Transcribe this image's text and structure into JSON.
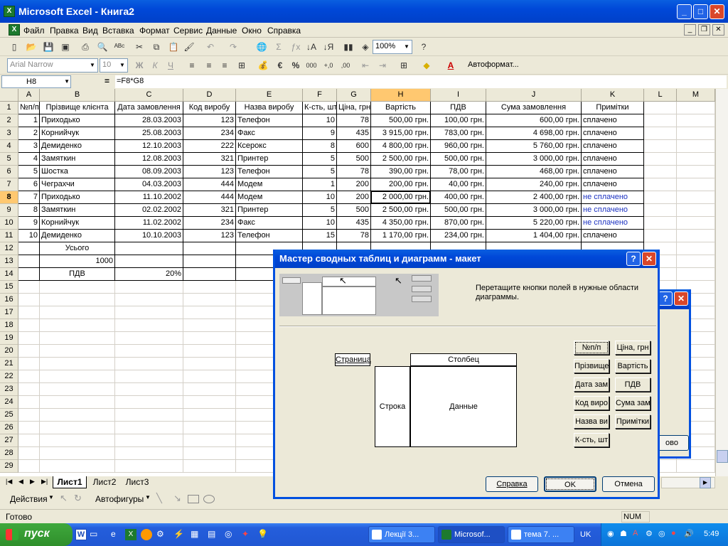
{
  "window": {
    "title": "Microsoft Excel - Книга2"
  },
  "menu": [
    "Файл",
    "Правка",
    "Вид",
    "Вставка",
    "Формат",
    "Сервис",
    "Данные",
    "Окно",
    "Справка"
  ],
  "toolbar": {
    "zoom": "100%",
    "font": "Arial Narrow",
    "size": "10",
    "autoformat": "Автоформат..."
  },
  "formula": {
    "name_box": "H8",
    "eq": "=",
    "content": "=F8*G8"
  },
  "columns": [
    "A",
    "B",
    "C",
    "D",
    "E",
    "F",
    "G",
    "H",
    "I",
    "J",
    "K",
    "L",
    "M"
  ],
  "rows": [
    "1",
    "2",
    "3",
    "4",
    "5",
    "6",
    "7",
    "8",
    "9",
    "10",
    "11",
    "12",
    "13",
    "14",
    "15",
    "16",
    "17",
    "18",
    "19",
    "20",
    "21",
    "22",
    "23",
    "24",
    "25",
    "26",
    "27",
    "28",
    "29"
  ],
  "table": {
    "headers": [
      "№п/п",
      "Прізвище клієнта",
      "Дата замовлення",
      "Код виробу",
      "Назва виробу",
      "К-сть, шт",
      "Ціна, грн",
      "Вартість",
      "ПДВ",
      "Сума замовлення",
      "Примітки"
    ],
    "rows": [
      [
        "1",
        "Приходько",
        "28.03.2003",
        "123",
        "Телефон",
        "10",
        "78",
        "500,00 грн.",
        "100,00 грн.",
        "600,00 грн.",
        "сплачено"
      ],
      [
        "2",
        "Корнийчук",
        "25.08.2003",
        "234",
        "Факс",
        "9",
        "435",
        "3 915,00 грн.",
        "783,00 грн.",
        "4 698,00 грн.",
        "сплачено"
      ],
      [
        "3",
        "Демиденко",
        "12.10.2003",
        "222",
        "Ксерокс",
        "8",
        "600",
        "4 800,00 грн.",
        "960,00 грн.",
        "5 760,00 грн.",
        "сплачено"
      ],
      [
        "4",
        "Замяткин",
        "12.08.2003",
        "321",
        "Принтер",
        "5",
        "500",
        "2 500,00 грн.",
        "500,00 грн.",
        "3 000,00 грн.",
        "сплачено"
      ],
      [
        "5",
        "Шостка",
        "08.09.2003",
        "123",
        "Телефон",
        "5",
        "78",
        "390,00 грн.",
        "78,00 грн.",
        "468,00 грн.",
        "сплачено"
      ],
      [
        "6",
        "Чеграхчи",
        "04.03.2003",
        "444",
        "Модем",
        "1",
        "200",
        "200,00 грн.",
        "40,00 грн.",
        "240,00 грн.",
        "сплачено"
      ],
      [
        "7",
        "Приходько",
        "11.10.2002",
        "444",
        "Модем",
        "10",
        "200",
        "2 000,00 грн.",
        "400,00 грн.",
        "2 400,00 грн.",
        "не сплачено"
      ],
      [
        "8",
        "Замяткин",
        "02.02.2002",
        "321",
        "Принтер",
        "5",
        "500",
        "2 500,00 грн.",
        "500,00 грн.",
        "3 000,00 грн.",
        "не сплачено"
      ],
      [
        "9",
        "Корнийчук",
        "11.02.2002",
        "234",
        "Факс",
        "10",
        "435",
        "4 350,00 грн.",
        "870,00 грн.",
        "5 220,00 грн.",
        "не сплачено"
      ],
      [
        "10",
        "Демиденко",
        "10.10.2003",
        "123",
        "Телефон",
        "15",
        "78",
        "1 170,00 грн.",
        "234,00 грн.",
        "1 404,00 грн.",
        "сплачено"
      ]
    ],
    "total_label": "Усього",
    "r13_value": "1000",
    "vat_label": "ПДВ",
    "vat_value": "20%"
  },
  "sheets": [
    "Лист1",
    "Лист2",
    "Лист3"
  ],
  "drawbar": {
    "actions": "Действия",
    "autoshapes": "Автофигуры"
  },
  "status": {
    "ready": "Готово",
    "num": "NUM"
  },
  "dialog": {
    "title": "Мастер сводных таблиц и диаграмм - макет",
    "instruction": "Перетащите кнопки полей в нужные области диаграммы.",
    "areas": {
      "page": "Страница",
      "column": "Столбец",
      "row": "Строка",
      "data": "Данные"
    },
    "fields_left": [
      "№п/п",
      "Прізвище",
      "Дата зам",
      "Код виро",
      "Назва ви",
      "К-сть, шт"
    ],
    "fields_right": [
      "Ціна, грн",
      "Вартість",
      "ПДВ",
      "Сума зам",
      "Примітки"
    ],
    "help": "Справка",
    "ok": "OK",
    "cancel": "Отмена",
    "back_dialog_btn": "ово"
  },
  "taskbar": {
    "start": "пуск",
    "tasks": [
      "Лекції 3...",
      "Microsof...",
      "тема 7. ..."
    ],
    "lang": "UK",
    "clock": "5:49"
  }
}
